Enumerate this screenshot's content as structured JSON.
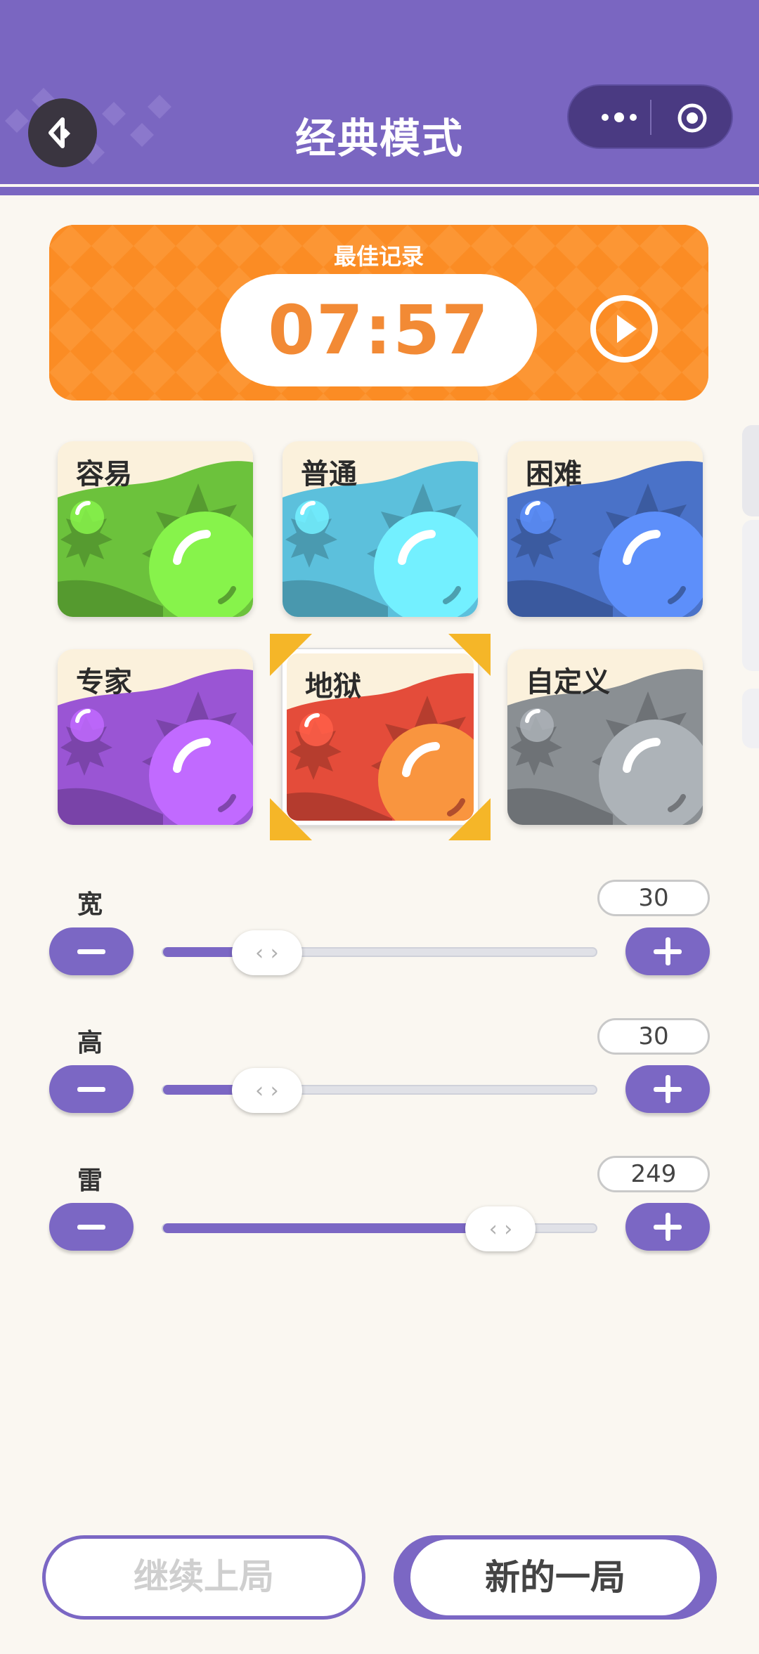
{
  "header": {
    "title": "经典模式",
    "back_icon": "back-icon",
    "menu_icon": "more-dots-icon",
    "close_icon": "target-icon",
    "color": "#7a66c1"
  },
  "record": {
    "label": "最佳记录",
    "time": "07:57",
    "play_icon": "play-icon",
    "color": "#fb8c24"
  },
  "difficulties": [
    {
      "label": "容易",
      "color": "#6cc23c",
      "selected": false
    },
    {
      "label": "普通",
      "color": "#5cc0dc",
      "selected": false
    },
    {
      "label": "困难",
      "color": "#4a72c8",
      "selected": false
    },
    {
      "label": "专家",
      "color": "#9a55d4",
      "selected": false
    },
    {
      "label": "地狱",
      "color": "#e44c3a",
      "selected": true
    },
    {
      "label": "自定义",
      "color": "#8a8f93",
      "selected": false
    }
  ],
  "sliders": {
    "width": {
      "label": "宽",
      "value": "30",
      "fill": 0.24
    },
    "height": {
      "label": "高",
      "value": "30",
      "fill": 0.24
    },
    "mines": {
      "label": "雷",
      "value": "249",
      "fill": 0.78
    }
  },
  "buttons": {
    "continue": "继续上局",
    "new_game": "新的一局"
  }
}
